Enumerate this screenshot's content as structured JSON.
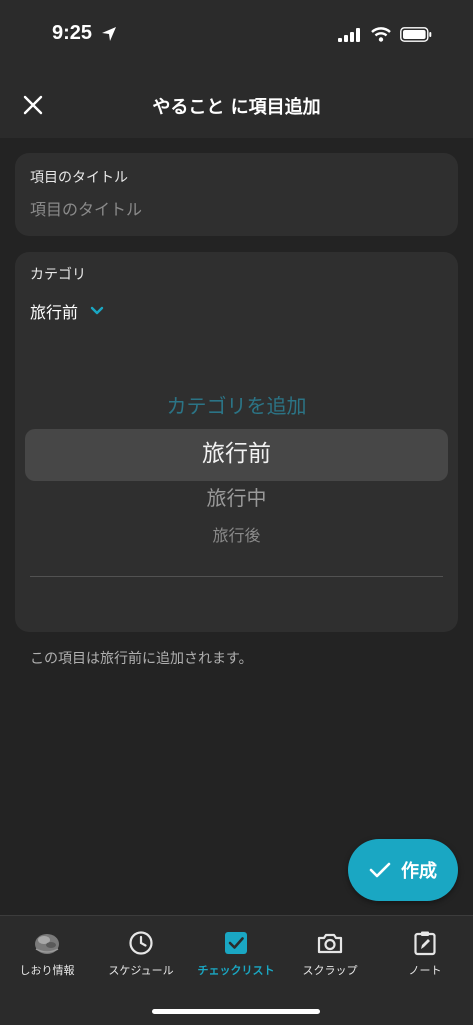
{
  "status_bar": {
    "time": "9:25"
  },
  "header": {
    "title": "やること に項目追加"
  },
  "title_field": {
    "label": "項目のタイトル",
    "placeholder": "項目のタイトル",
    "value": ""
  },
  "category": {
    "label": "カテゴリ",
    "selected": "旅行前",
    "picker_options": [
      "カテゴリを追加",
      "旅行前",
      "旅行中",
      "旅行後"
    ]
  },
  "info_note": "この項目は旅行前に追加されます。",
  "create_button": {
    "label": "作成"
  },
  "tabs": [
    {
      "label": "しおり情報",
      "icon": "avatar-icon"
    },
    {
      "label": "スケジュール",
      "icon": "clock-icon"
    },
    {
      "label": "チェックリスト",
      "icon": "checkbox-icon",
      "active": true
    },
    {
      "label": "スクラップ",
      "icon": "camera-icon"
    },
    {
      "label": "ノート",
      "icon": "clipboard-edit-icon"
    }
  ],
  "colors": {
    "accent": "#1aa7c3",
    "background": "#232323",
    "card": "#2f2f2f",
    "bar": "#2b2b2b"
  }
}
